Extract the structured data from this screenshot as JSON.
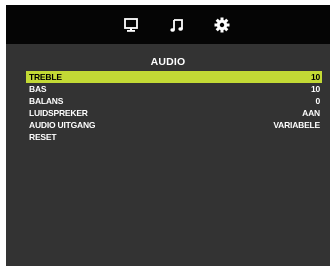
{
  "topbar": {
    "tabs": [
      {
        "icon": "monitor-icon"
      },
      {
        "icon": "music-note-icon"
      },
      {
        "icon": "gear-icon"
      }
    ]
  },
  "title": "AUDIO",
  "colors": {
    "highlight": "#c3da35",
    "panel": "#333333",
    "topbar": "#050505"
  },
  "menu": [
    {
      "label": "TREBLE",
      "value": "10",
      "selected": true
    },
    {
      "label": "BAS",
      "value": "10"
    },
    {
      "label": "BALANS",
      "value": "0"
    },
    {
      "label": "LUIDSPREKER",
      "value": "AAN"
    },
    {
      "label": "AUDIO UITGANG",
      "value": "VARIABELE"
    },
    {
      "label": "RESET",
      "value": ""
    }
  ]
}
